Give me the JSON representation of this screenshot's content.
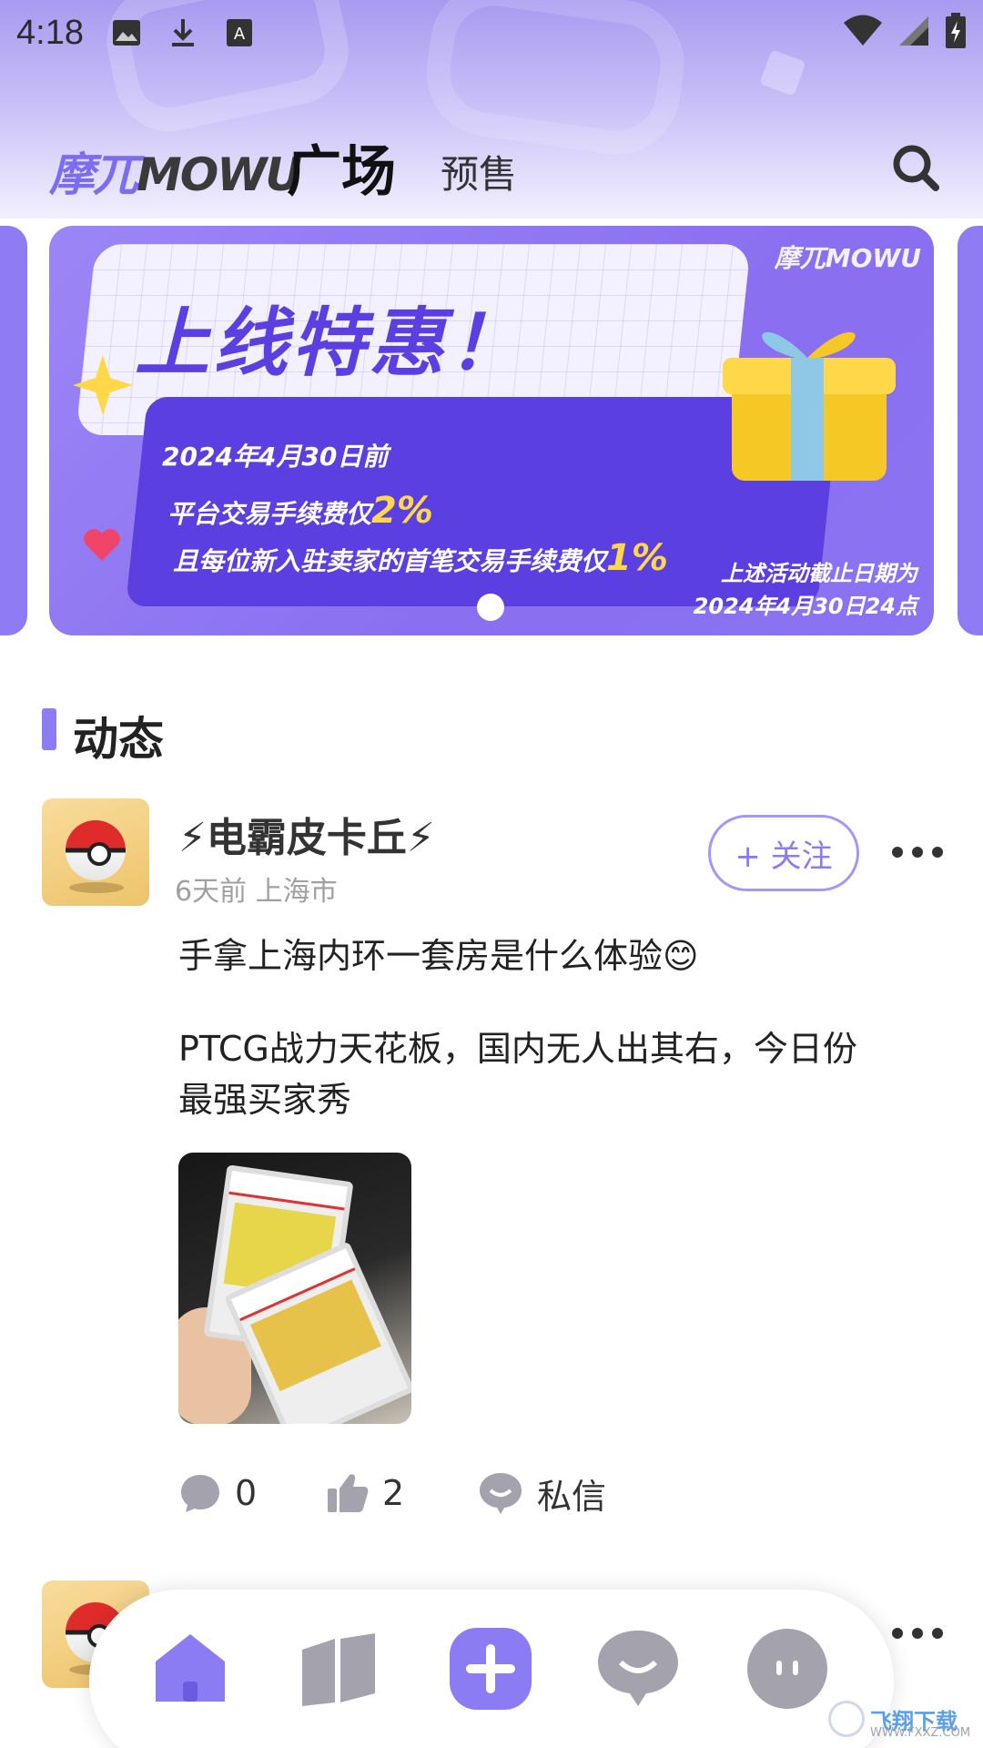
{
  "status_bar": {
    "time": "4:18"
  },
  "top_nav": {
    "logo_a": "摩兀",
    "logo_b": "MOWU",
    "tabs": [
      {
        "label": "广场",
        "active": true
      },
      {
        "label": "预售",
        "active": false
      }
    ]
  },
  "banner": {
    "brand": "摩兀MOWU",
    "headline": "上线特惠！",
    "line1": "2024年4月30日前",
    "line2_prefix": "平台交易手续费仅",
    "line2_value": "2%",
    "line3_prefix": "且每位新入驻卖家的首笔交易手续费仅",
    "line3_value": "1%",
    "note1": "上述活动截止日期为",
    "note2": "2024年4月30日24点",
    "current_slide": 1
  },
  "section": {
    "title": "动态"
  },
  "post": {
    "author": "⚡电霸皮卡丘⚡",
    "meta": "6天前 上海市",
    "follow_label": "+ 关注",
    "text_line1": "手拿上海内环一套房是什么体验😊",
    "text_line2": "PTCG战力天花板，国内无人出其右，今日份",
    "text_line3": "最强买家秀",
    "comments": "0",
    "likes": "2",
    "message_label": "私信"
  },
  "colors": {
    "accent": "#8b7cf3",
    "banner": "#8a6ff0",
    "nav_inactive": "#a4a3ad"
  },
  "watermark": {
    "text": "飞翔下载",
    "url": "WWW.FXXZ.COM"
  }
}
